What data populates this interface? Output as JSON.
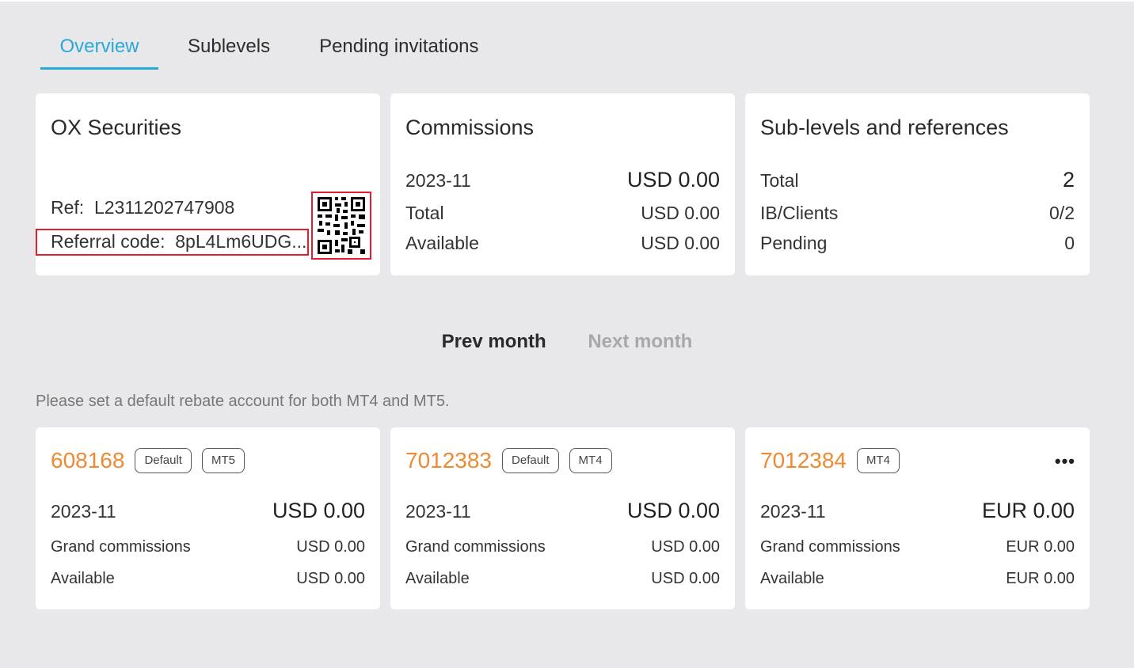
{
  "tabs": {
    "overview": "Overview",
    "sublevels": "Sublevels",
    "pending": "Pending invitations"
  },
  "brand_card": {
    "title": "OX Securities",
    "ref_label": "Ref:",
    "ref_value": "L2311202747908",
    "referral_label": "Referral code:",
    "referral_value": "8pL4Lm6UDG..."
  },
  "commissions_card": {
    "title": "Commissions",
    "period": "2023-11",
    "period_value": "USD 0.00",
    "total_label": "Total",
    "total_value": "USD 0.00",
    "available_label": "Available",
    "available_value": "USD 0.00"
  },
  "sublevels_card": {
    "title": "Sub-levels and references",
    "total_label": "Total",
    "total_value": "2",
    "ib_label": "IB/Clients",
    "ib_value": "0/2",
    "pending_label": "Pending",
    "pending_value": "0"
  },
  "month_nav": {
    "prev": "Prev month",
    "next": "Next month"
  },
  "notice": "Please set a default rebate account for both MT4 and MT5.",
  "accounts": [
    {
      "number": "608168",
      "badges": [
        "Default",
        "MT5"
      ],
      "period": "2023-11",
      "period_value": "USD 0.00",
      "grand_label": "Grand commissions",
      "grand_value": "USD 0.00",
      "available_label": "Available",
      "available_value": "USD 0.00"
    },
    {
      "number": "7012383",
      "badges": [
        "Default",
        "MT4"
      ],
      "period": "2023-11",
      "period_value": "USD 0.00",
      "grand_label": "Grand commissions",
      "grand_value": "USD 0.00",
      "available_label": "Available",
      "available_value": "USD 0.00"
    },
    {
      "number": "7012384",
      "badges": [
        "MT4"
      ],
      "more": "•••",
      "period": "2023-11",
      "period_value": "EUR 0.00",
      "grand_label": "Grand commissions",
      "grand_value": "EUR 0.00",
      "available_label": "Available",
      "available_value": "EUR 0.00"
    }
  ],
  "colors": {
    "accent": "#2aa8d8",
    "account_number": "#ee8a32",
    "highlight_border": "#e01e2f",
    "background": "#e8e8ea"
  },
  "icons": {
    "qr": "qr-code-icon",
    "more": "more-options-icon"
  }
}
